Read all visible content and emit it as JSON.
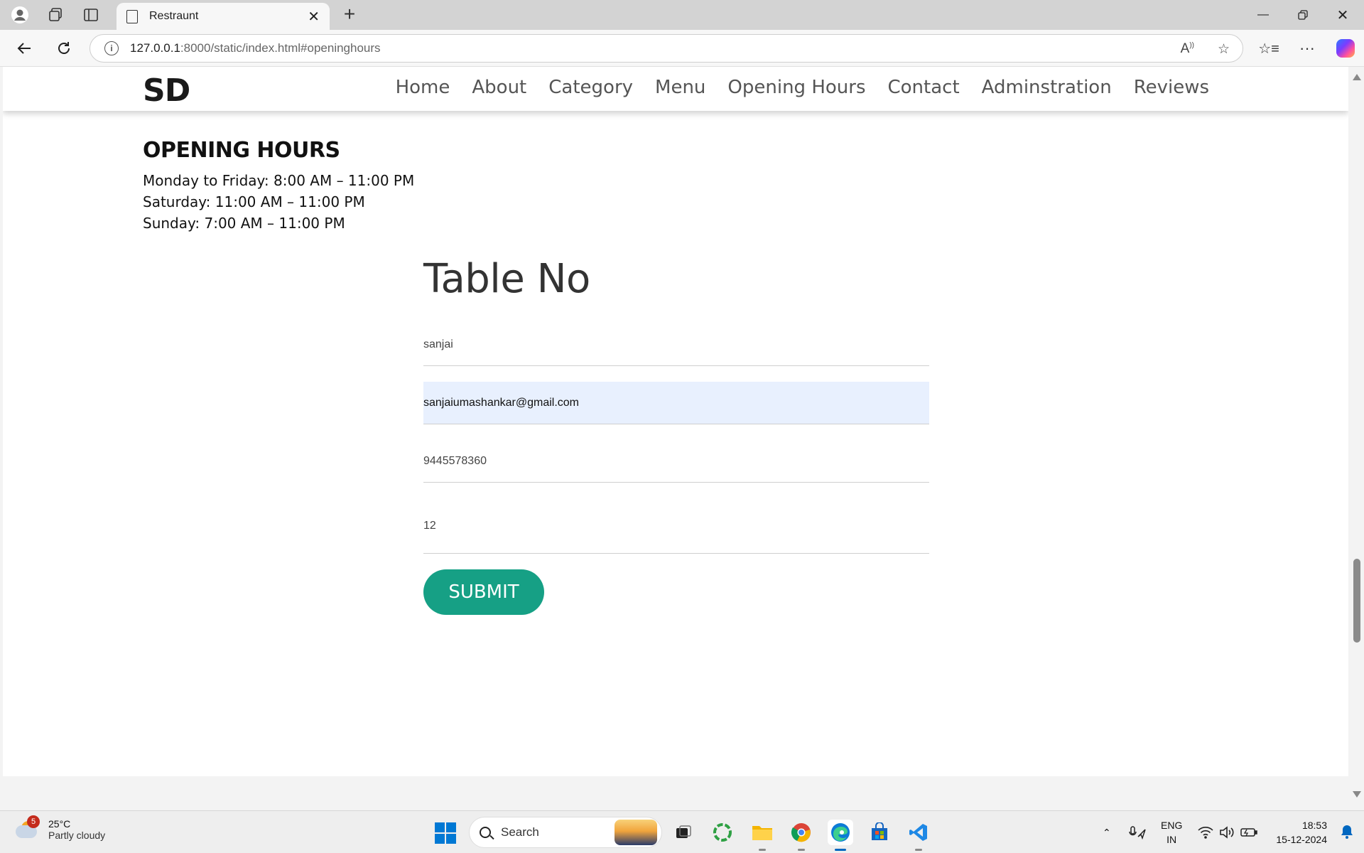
{
  "browser": {
    "tab_title": "Restraunt",
    "url_host": "127.0.0.1",
    "url_rest": ":8000/static/index.html#openinghours"
  },
  "site": {
    "logo": "SD",
    "nav": [
      "Home",
      "About",
      "Category",
      "Menu",
      "Opening Hours",
      "Contact",
      "Adminstration",
      "Reviews"
    ]
  },
  "opening_hours": {
    "heading": "OPENING HOURS",
    "lines": [
      "Monday to Friday: 8:00 AM – 11:00 PM",
      "Saturday: 11:00 AM – 11:00 PM",
      "Sunday: 7:00 AM – 11:00 PM"
    ]
  },
  "form": {
    "title": "Table No",
    "name_value": "sanjai",
    "email_value": "sanjaiumashankar@gmail.com",
    "phone_value": "9445578360",
    "table_value": "12",
    "submit_label": "SUBMIT"
  },
  "taskbar": {
    "weather_badge": "5",
    "temperature": "25°C",
    "weather_desc": "Partly cloudy",
    "search_label": "Search",
    "lang_line1": "ENG",
    "lang_line2": "IN",
    "time": "18:53",
    "date": "15-12-2024"
  },
  "colors": {
    "accent_button": "#16a085",
    "autofill_bg": "#e8f0fe"
  }
}
